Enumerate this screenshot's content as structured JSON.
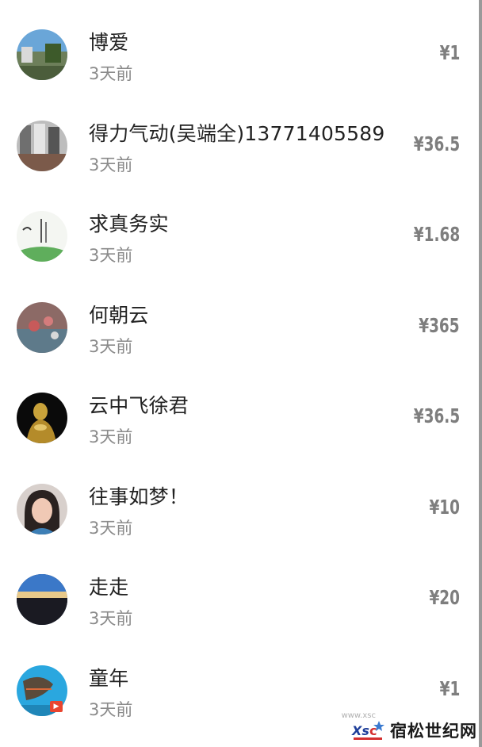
{
  "donations": [
    {
      "name": "博爱",
      "time": "3天前",
      "amount": "¥1",
      "avatar_icon": "landscape-photo-icon"
    },
    {
      "name": "得力气动(吴端全)13771405589",
      "time": "3天前",
      "amount": "¥36.5",
      "avatar_icon": "machinery-photo-icon"
    },
    {
      "name": "求真务实",
      "time": "3天前",
      "amount": "¥1.68",
      "avatar_icon": "ink-painting-icon"
    },
    {
      "name": "何朝云",
      "time": "3天前",
      "amount": "¥365",
      "avatar_icon": "flowers-photo-icon"
    },
    {
      "name": "云中飞徐君",
      "time": "3天前",
      "amount": "¥36.5",
      "avatar_icon": "golden-buddha-icon"
    },
    {
      "name": "往事如梦！",
      "time": "3天前",
      "amount": "¥10",
      "avatar_icon": "portrait-photo-icon"
    },
    {
      "name": "走走",
      "time": "3天前",
      "amount": "¥20",
      "avatar_icon": "horizon-photo-icon"
    },
    {
      "name": "童年",
      "time": "3天前",
      "amount": "¥1",
      "avatar_icon": "fish-tank-photo-icon"
    }
  ],
  "watermark": {
    "brand": "宿松世纪网",
    "logo_text": "Xsc",
    "url_hint": "www.xsc"
  },
  "colors": {
    "name_text": "#222222",
    "time_text": "#8a8a8a",
    "amount_text": "#7e7e7e",
    "badge": "#e9452f"
  }
}
